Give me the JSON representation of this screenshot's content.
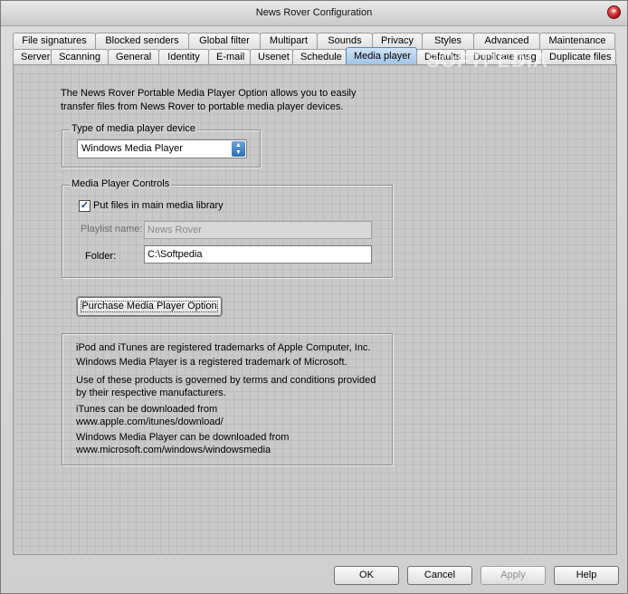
{
  "window": {
    "title": "News Rover Configuration"
  },
  "tabs": {
    "row1": [
      "File signatures",
      "Blocked senders",
      "Global filter",
      "Multipart",
      "Sounds",
      "Privacy",
      "Styles",
      "Advanced",
      "Maintenance"
    ],
    "row2": [
      "Server",
      "Scanning",
      "General",
      "Identity",
      "E-mail",
      "Usenet",
      "Schedule",
      "Media player",
      "Defaults",
      "Duplicate msg",
      "Duplicate files"
    ],
    "active": "Media player"
  },
  "watermark": "SOFTPEDIA",
  "intro": {
    "line1": "The News Rover Portable Media Player Option allows you to easily",
    "line2": "transfer files from News Rover to portable media player devices."
  },
  "device_group": {
    "legend": "Type of media player device",
    "selected": "Windows Media Player"
  },
  "controls_group": {
    "legend": "Media Player Controls",
    "checkbox_label": "Put files in main media library",
    "checkbox_checked": true,
    "playlist_label": "Playlist name:",
    "playlist_value": "News Rover",
    "folder_label": "Folder:",
    "folder_value": "C:\\Softpedia"
  },
  "purchase_button": "Purchase Media Player Option",
  "info": {
    "l1": "iPod and iTunes are registered trademarks of Apple Computer, Inc.",
    "l2": "Windows Media Player is a registered trademark of Microsoft.",
    "l3": "Use of these products is governed by terms and conditions provided",
    "l4": "by their respective manufacturers.",
    "l5": "iTunes can be downloaded from",
    "l6": "www.apple.com/itunes/download/",
    "l7": "Windows Media Player can be downloaded from",
    "l8": "www.microsoft.com/windows/windowsmedia"
  },
  "footer": {
    "ok": "OK",
    "cancel": "Cancel",
    "apply": "Apply",
    "help": "Help"
  }
}
